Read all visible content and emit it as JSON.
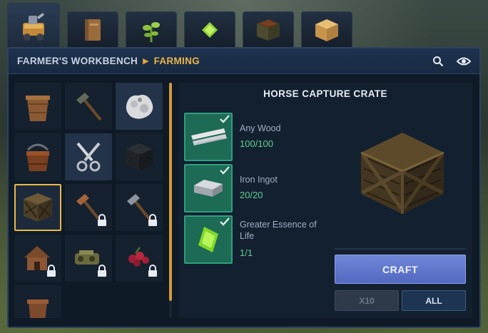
{
  "tabs": [
    {
      "icon": "farmer-workbench-icon",
      "active": true
    },
    {
      "icon": "book-icon",
      "active": false
    },
    {
      "icon": "plant-sprout-icon",
      "active": false
    },
    {
      "icon": "green-essence-icon",
      "active": false
    },
    {
      "icon": "planter-box-icon",
      "active": false
    },
    {
      "icon": "wooden-block-icon",
      "active": false
    }
  ],
  "header": {
    "breadcrumb_root": "FARMER'S WORKBENCH",
    "breadcrumb_current": "FARMING",
    "search_icon": "search-icon",
    "view_icon": "eye-icon"
  },
  "items": [
    {
      "icon": "planter-pot-icon",
      "locked": false,
      "selected": false
    },
    {
      "icon": "hoe-icon",
      "locked": false,
      "selected": false
    },
    {
      "icon": "wool-icon",
      "locked": false,
      "selected": false,
      "highlight": true
    },
    {
      "icon": "bucket-icon",
      "locked": false,
      "selected": false
    },
    {
      "icon": "shears-icon",
      "locked": false,
      "selected": false,
      "highlight": true
    },
    {
      "icon": "dark-crate-icon",
      "locked": false,
      "selected": false
    },
    {
      "icon": "horse-capture-crate-icon",
      "locked": false,
      "selected": true
    },
    {
      "icon": "copper-hoe-icon",
      "locked": true,
      "selected": false
    },
    {
      "icon": "iron-hoe-icon",
      "locked": true,
      "selected": false
    },
    {
      "icon": "coop-icon",
      "locked": true,
      "selected": false
    },
    {
      "icon": "grinder-icon",
      "locked": true,
      "selected": false
    },
    {
      "icon": "berries-icon",
      "locked": true,
      "selected": false
    },
    {
      "icon": "small-pot-icon",
      "locked": false,
      "selected": false
    }
  ],
  "recipe": {
    "title": "HORSE CAPTURE CRATE",
    "ingredients": [
      {
        "name": "Any Wood",
        "qty": "100/100",
        "icon": "wood-planks-icon"
      },
      {
        "name": "Iron Ingot",
        "qty": "20/20",
        "icon": "iron-ingot-icon"
      },
      {
        "name": "Greater Essence of Life",
        "qty": "1/1",
        "icon": "life-essence-icon"
      }
    ],
    "preview_icon": "wooden-crate-icon",
    "craft_label": "CRAFT",
    "x10_label": "X10",
    "all_label": "ALL"
  },
  "colors": {
    "accent_gold": "#e8b84a",
    "craft_blue": "#5f77cc",
    "ingredient_green": "#1d6a55",
    "qty_green": "#5fd08e"
  }
}
